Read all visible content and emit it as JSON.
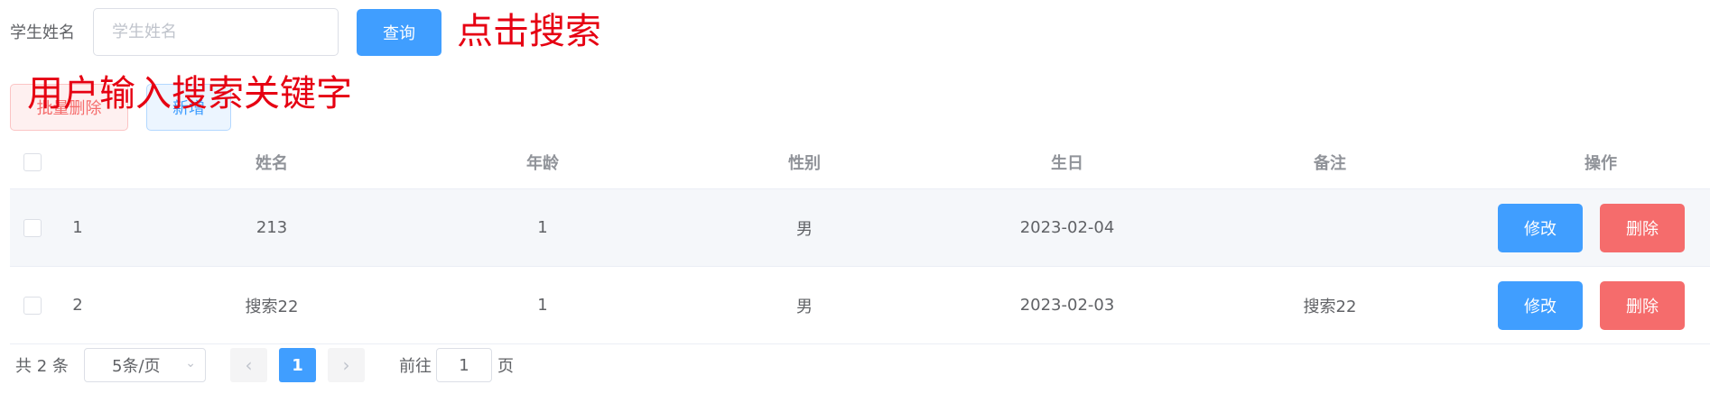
{
  "search": {
    "label": "学生姓名",
    "placeholder": "学生姓名",
    "value": "",
    "query_label": "查询"
  },
  "annotations": {
    "click_hint": "点击搜索",
    "input_hint": "用户输入搜索关键字"
  },
  "actions": {
    "batch_delete_label": "批量删除",
    "add_label": "新增"
  },
  "table": {
    "columns": [
      "姓名",
      "年龄",
      "性别",
      "生日",
      "备注",
      "操作"
    ],
    "rows": [
      {
        "index": "1",
        "name": "213",
        "age": "1",
        "gender": "男",
        "birthday": "2023-02-04",
        "note": "",
        "edit_label": "修改",
        "delete_label": "删除"
      },
      {
        "index": "2",
        "name": "搜索22",
        "age": "1",
        "gender": "男",
        "birthday": "2023-02-03",
        "note": "搜索22",
        "edit_label": "修改",
        "delete_label": "删除"
      }
    ]
  },
  "pagination": {
    "total_text": "共 2 条",
    "page_size": "5条/页",
    "current_page": "1",
    "goto_label": "前往",
    "goto_value": "1",
    "goto_suffix": "页"
  },
  "colors": {
    "primary": "#409eff",
    "danger": "#f56c6c",
    "annotation": "#e60012"
  }
}
